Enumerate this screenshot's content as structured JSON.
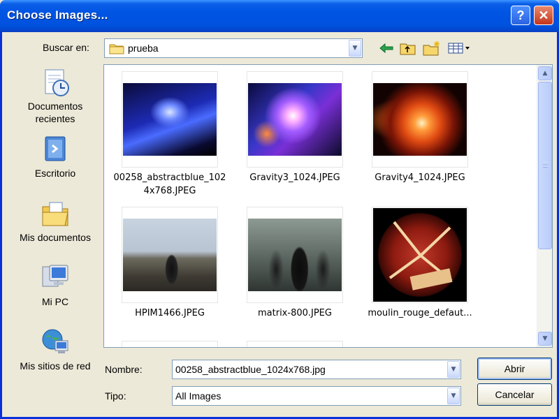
{
  "window": {
    "title": "Choose Images..."
  },
  "title_buttons": {
    "help": "?",
    "close": "✕"
  },
  "lookin": {
    "label": "Buscar en:",
    "value": "prueba"
  },
  "toolbar": {
    "icons": [
      "back-icon",
      "up-folder-icon",
      "new-folder-icon",
      "view-menu-icon"
    ]
  },
  "places": [
    {
      "label": "Documentos recientes",
      "icon": "recent-documents-icon"
    },
    {
      "label": "Escritorio",
      "icon": "desktop-icon"
    },
    {
      "label": "Mis documentos",
      "icon": "my-documents-icon"
    },
    {
      "label": "Mi PC",
      "icon": "my-computer-icon"
    },
    {
      "label": "Mis sitios de red",
      "icon": "network-places-icon"
    }
  ],
  "files": [
    {
      "name": "00258_abstractblue_1024x768.JPEG",
      "line1": "00258_abstractblue_102",
      "line2": "4x768.JPEG",
      "selected": false
    },
    {
      "name": "Gravity3_1024.JPEG",
      "line1": "Gravity3_1024.JPEG",
      "line2": "",
      "selected": false
    },
    {
      "name": "Gravity4_1024.JPEG",
      "line1": "Gravity4_1024.JPEG",
      "line2": "",
      "selected": false
    },
    {
      "name": "HPIM1466.JPEG",
      "line1": "HPIM1466.JPEG",
      "line2": "",
      "selected": false
    },
    {
      "name": "matrix-800.JPEG",
      "line1": "matrix-800.JPEG",
      "line2": "",
      "selected": false
    },
    {
      "name": "moulin_rouge_defaut...",
      "line1": "moulin_rouge_defaut...",
      "line2": "",
      "selected": false
    }
  ],
  "filename": {
    "label": "Nombre:",
    "value": "00258_abstractblue_1024x768.jpg"
  },
  "filetype": {
    "label": "Tipo:",
    "value": "All Images"
  },
  "buttons": {
    "open": "Abrir",
    "cancel": "Cancelar"
  },
  "colors": {
    "titlebar": "#0054e3",
    "dialog_bg": "#ece9d8",
    "accent_border": "#7f9db9"
  }
}
